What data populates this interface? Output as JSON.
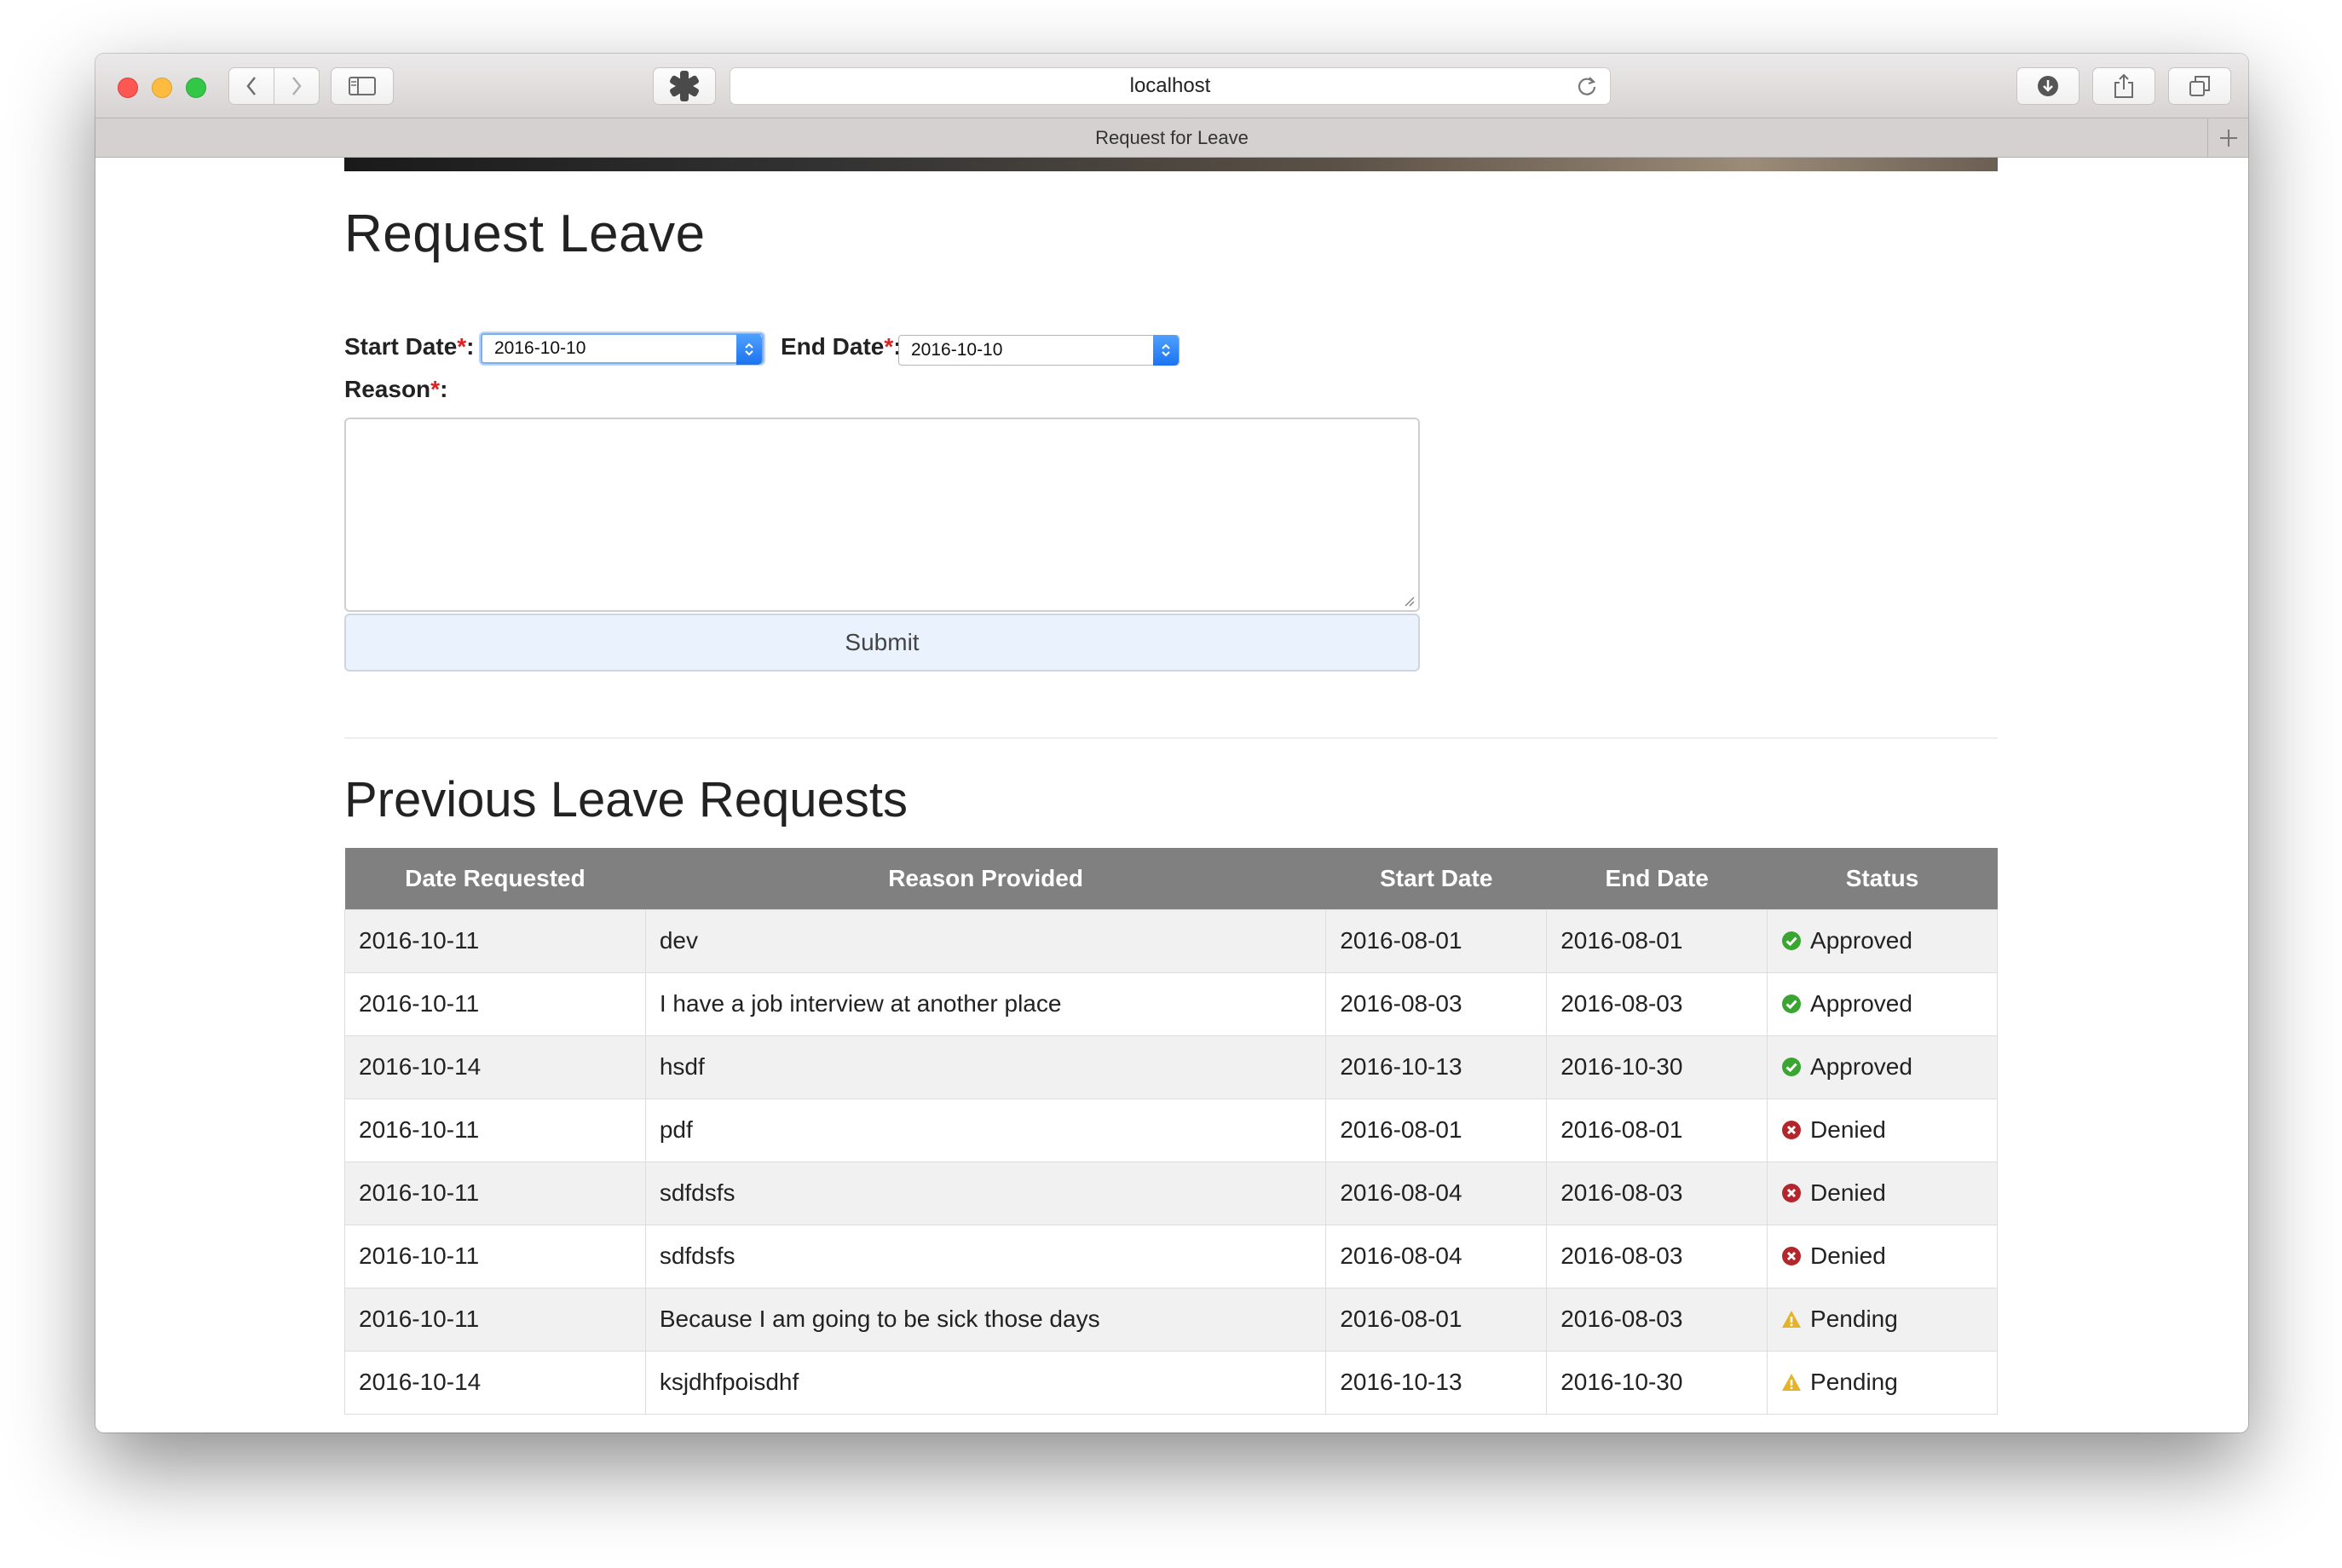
{
  "browser": {
    "address": "localhost",
    "tab_title": "Request for Leave"
  },
  "form": {
    "title": "Request Leave",
    "start_label": "Start Date",
    "end_label": "End Date",
    "reason_label": "Reason",
    "required_mark": "*",
    "colon": ":",
    "start_value": "2016-10-10",
    "end_value": "2016-10-10",
    "reason_value": "",
    "submit_label": "Submit"
  },
  "history": {
    "title": "Previous Leave Requests",
    "columns": [
      "Date Requested",
      "Reason Provided",
      "Start Date",
      "End Date",
      "Status"
    ],
    "rows": [
      {
        "requested": "2016-10-11",
        "reason": "dev",
        "start": "2016-08-01",
        "end": "2016-08-01",
        "status": "Approved",
        "icon": "check-circle-icon"
      },
      {
        "requested": "2016-10-11",
        "reason": "I have a job interview at another place",
        "start": "2016-08-03",
        "end": "2016-08-03",
        "status": "Approved",
        "icon": "check-circle-icon"
      },
      {
        "requested": "2016-10-14",
        "reason": "hsdf",
        "start": "2016-10-13",
        "end": "2016-10-30",
        "status": "Approved",
        "icon": "check-circle-icon"
      },
      {
        "requested": "2016-10-11",
        "reason": "pdf",
        "start": "2016-08-01",
        "end": "2016-08-01",
        "status": "Denied",
        "icon": "x-circle-icon"
      },
      {
        "requested": "2016-10-11",
        "reason": "sdfdsfs",
        "start": "2016-08-04",
        "end": "2016-08-03",
        "status": "Denied",
        "icon": "x-circle-icon"
      },
      {
        "requested": "2016-10-11",
        "reason": "sdfdsfs",
        "start": "2016-08-04",
        "end": "2016-08-03",
        "status": "Denied",
        "icon": "x-circle-icon"
      },
      {
        "requested": "2016-10-11",
        "reason": "Because I am going to be sick those days",
        "start": "2016-08-01",
        "end": "2016-08-03",
        "status": "Pending",
        "icon": "warning-icon"
      },
      {
        "requested": "2016-10-14",
        "reason": "ksjdhfpoisdhf",
        "start": "2016-10-13",
        "end": "2016-10-30",
        "status": "Pending",
        "icon": "warning-icon"
      }
    ]
  },
  "colors": {
    "approved": "#3aa531",
    "denied": "#b3262b",
    "pending": "#e5b32a",
    "header_bg": "#808080",
    "required": "#e02020"
  }
}
